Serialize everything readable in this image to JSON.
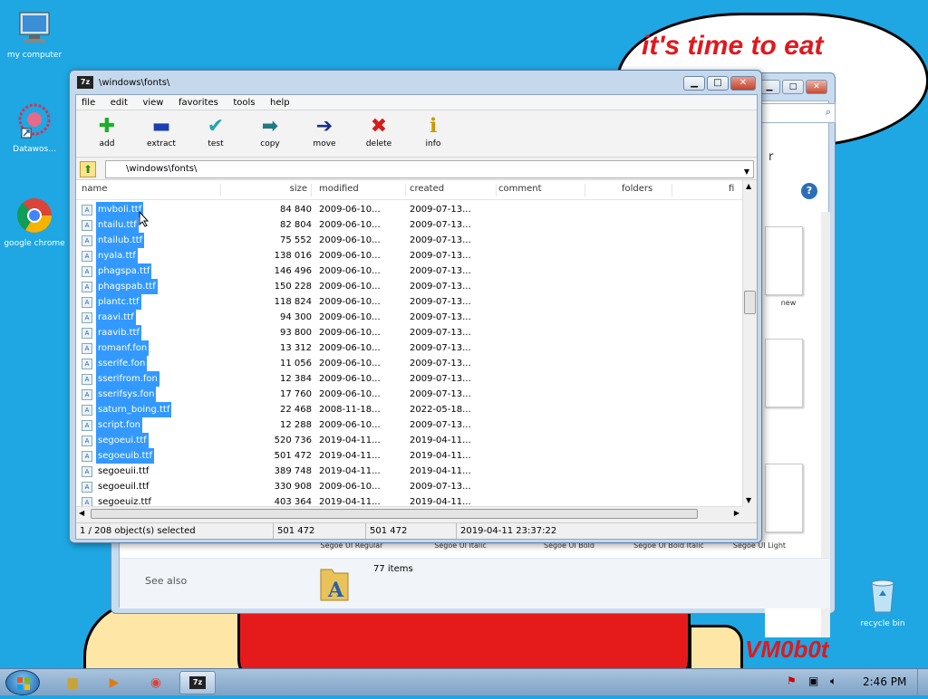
{
  "wallpaper": {
    "bubble_text": "it's time to eat",
    "signature": "VM0b0t"
  },
  "desktop_icons": [
    {
      "label": "my computer",
      "icon": "computer-icon"
    },
    {
      "label": "Datawos...",
      "icon": "shortcut-icon"
    },
    {
      "label": "google chrome",
      "icon": "chrome-icon"
    },
    {
      "label": "recycle bin",
      "icon": "recycle-bin-icon"
    }
  ],
  "bg_window": {
    "items": [
      "new",
      "Segoe UI Regular",
      "Segoe UI Italic",
      "Segoe UI Bold",
      "Segoe UI Bold Italic",
      "Segoe UI Light"
    ],
    "see_also": "See also",
    "items_count": "77 items",
    "partial_label": "r"
  },
  "zip": {
    "title": "\\windows\\fonts\\",
    "menu": [
      "file",
      "edit",
      "view",
      "favorites",
      "tools",
      "help"
    ],
    "toolbar": [
      {
        "label": "add",
        "glyph": "✚",
        "color": "#1fae2a"
      },
      {
        "label": "extract",
        "glyph": "▬",
        "color": "#1a3fb0"
      },
      {
        "label": "test",
        "glyph": "✔",
        "color": "#20a6b8"
      },
      {
        "label": "copy",
        "glyph": "➡",
        "color": "#1f7a86"
      },
      {
        "label": "move",
        "glyph": "➔",
        "color": "#1a2f8c"
      },
      {
        "label": "delete",
        "glyph": "✖",
        "color": "#d41c1c"
      },
      {
        "label": "info",
        "glyph": "ℹ",
        "color": "#c89a00"
      }
    ],
    "address": "\\windows\\fonts\\",
    "columns": [
      "name",
      "size",
      "modified",
      "created",
      "comment",
      "folders",
      "fi"
    ],
    "files": [
      {
        "name": "mvboli.ttf",
        "size": "84 840",
        "modified": "2009-06-10...",
        "created": "2009-07-13...",
        "selected": true
      },
      {
        "name": "ntailu.ttf",
        "size": "82 804",
        "modified": "2009-06-10...",
        "created": "2009-07-13...",
        "selected": true
      },
      {
        "name": "ntailub.ttf",
        "size": "75 552",
        "modified": "2009-06-10...",
        "created": "2009-07-13...",
        "selected": true
      },
      {
        "name": "nyala.ttf",
        "size": "138 016",
        "modified": "2009-06-10...",
        "created": "2009-07-13...",
        "selected": true
      },
      {
        "name": "phagspa.ttf",
        "size": "146 496",
        "modified": "2009-06-10...",
        "created": "2009-07-13...",
        "selected": true
      },
      {
        "name": "phagspab.ttf",
        "size": "150 228",
        "modified": "2009-06-10...",
        "created": "2009-07-13...",
        "selected": true
      },
      {
        "name": "plantc.ttf",
        "size": "118 824",
        "modified": "2009-06-10...",
        "created": "2009-07-13...",
        "selected": true
      },
      {
        "name": "raavi.ttf",
        "size": "94 300",
        "modified": "2009-06-10...",
        "created": "2009-07-13...",
        "selected": true
      },
      {
        "name": "raavib.ttf",
        "size": "93 800",
        "modified": "2009-06-10...",
        "created": "2009-07-13...",
        "selected": true
      },
      {
        "name": "romanf.fon",
        "size": "13 312",
        "modified": "2009-06-10...",
        "created": "2009-07-13...",
        "selected": true
      },
      {
        "name": "sserife.fon",
        "size": "11 056",
        "modified": "2009-06-10...",
        "created": "2009-07-13...",
        "selected": true
      },
      {
        "name": "sserifrom.fon",
        "size": "12 384",
        "modified": "2009-06-10...",
        "created": "2009-07-13...",
        "selected": true
      },
      {
        "name": "sserifsys.fon",
        "size": "17 760",
        "modified": "2009-06-10...",
        "created": "2009-07-13...",
        "selected": true
      },
      {
        "name": "saturn_boing.ttf",
        "size": "22 468",
        "modified": "2008-11-18...",
        "created": "2022-05-18...",
        "selected": true
      },
      {
        "name": "script.fon",
        "size": "12 288",
        "modified": "2009-06-10...",
        "created": "2009-07-13...",
        "selected": true
      },
      {
        "name": "segoeui.ttf",
        "size": "520 736",
        "modified": "2019-04-11...",
        "created": "2019-04-11...",
        "selected": true
      },
      {
        "name": "segoeuib.ttf",
        "size": "501 472",
        "modified": "2019-04-11...",
        "created": "2019-04-11...",
        "selected": true
      },
      {
        "name": "segoeuii.ttf",
        "size": "389 748",
        "modified": "2019-04-11...",
        "created": "2019-04-11...",
        "selected": false
      },
      {
        "name": "segoeuil.ttf",
        "size": "330 908",
        "modified": "2009-06-10...",
        "created": "2009-07-13...",
        "selected": false
      },
      {
        "name": "segoeuiz.ttf",
        "size": "403 364",
        "modified": "2019-04-11...",
        "created": "2019-04-11...",
        "selected": false
      }
    ],
    "status": {
      "selection": "1 / 208 object(s) selected",
      "size": "501 472",
      "packed": "501 472",
      "date": "2019-04-11 23:37:22"
    }
  },
  "taskbar": {
    "clock": "2:46 PM"
  }
}
